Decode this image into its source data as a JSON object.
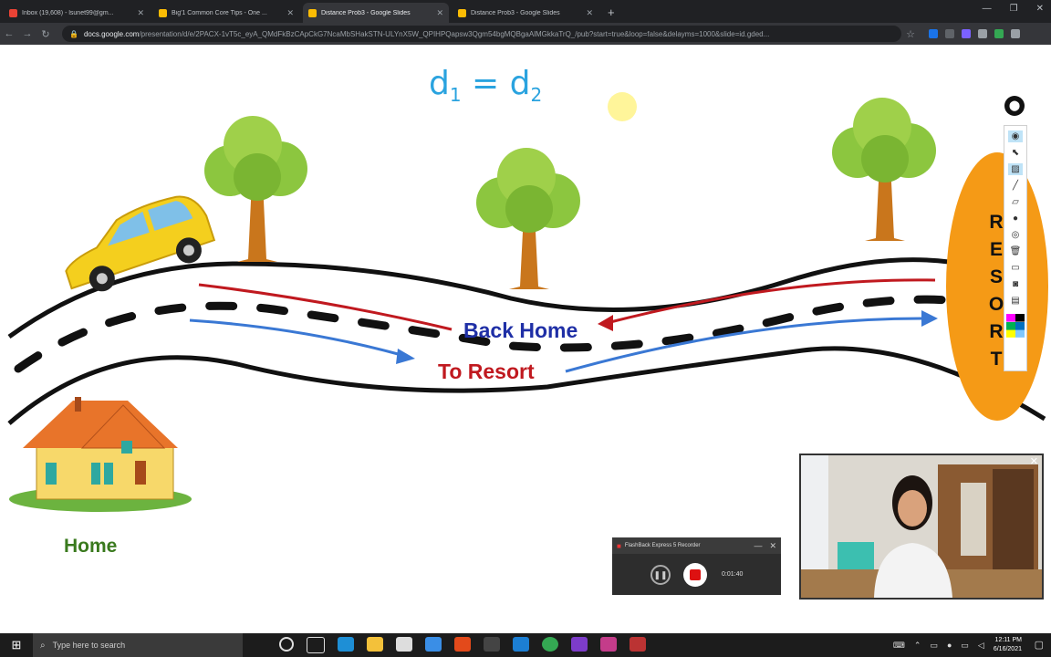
{
  "browser": {
    "tabs": [
      {
        "title": "Inbox (19,608) - lsunet99@gm...",
        "favicon_color": "#ea4335",
        "active": false
      },
      {
        "title": "Big'1 Common Core Tips - One ...",
        "favicon_color": "#fbbc04",
        "active": false
      },
      {
        "title": "Distance Prob3 - Google Slides",
        "favicon_color": "#fbbc04",
        "active": true
      },
      {
        "title": "Distance Prob3 - Google Slides",
        "favicon_color": "#fbbc04",
        "active": false
      }
    ],
    "tab_close": "✕",
    "new_tab": "+",
    "url_host": "docs.google.com",
    "url_path": "/presentation/d/e/2PACX-1vT5c_eyA_QMdFkBzCApCkG7NcaMbSHakSTN-ULYnX5W_QPIHPQapsw3Qgm54bgMQBgaAlMGkkaTrQ_/pub?start=true&loop=false&delayms=1000&slide=id.gded..."
  },
  "slide": {
    "formula": {
      "d": "d",
      "sub1": "1",
      "equals": " = ",
      "sub2": "2"
    },
    "back_home_label": "Back Home",
    "to_resort_label": "To Resort",
    "home_label": "Home",
    "resort_letters": [
      "R",
      "E",
      "S",
      "O",
      "R",
      "T"
    ],
    "colors": {
      "road": "#111111",
      "back_arrow": "#c0191f",
      "to_arrow": "#3a78d4",
      "resort": "#f59a16",
      "car": "#f4cf1e"
    }
  },
  "recorder": {
    "title": "FlashBack Express 5 Recorder",
    "timer": "0:01:40",
    "minimize": "—",
    "close": "✕",
    "pause_icon": "❚❚"
  },
  "webcam": {
    "close": "✕"
  },
  "taskbar": {
    "search_placeholder": "Type here to search",
    "time": "12:11 PM",
    "date": "6/16/2021"
  }
}
